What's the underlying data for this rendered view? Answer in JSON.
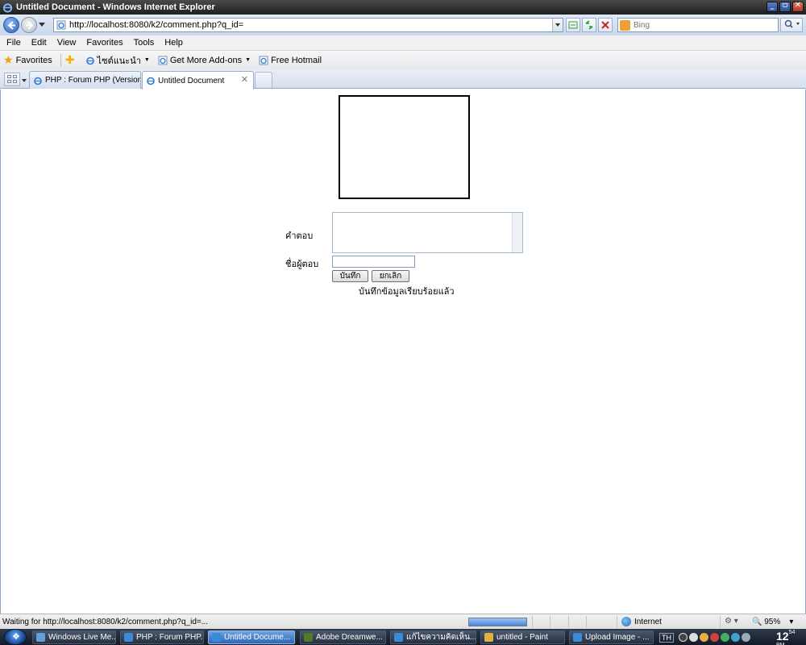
{
  "window": {
    "title": "Untitled Document - Windows Internet Explorer"
  },
  "address": {
    "url": "http://localhost:8080/k2/comment.php?q_id="
  },
  "search": {
    "placeholder": "Bing"
  },
  "menu": [
    "File",
    "Edit",
    "View",
    "Favorites",
    "Tools",
    "Help"
  ],
  "favorites": {
    "label": "Favorites",
    "items": [
      "ไซต์แนะนำ",
      "Get More Add-ons",
      "Free Hotmail"
    ]
  },
  "tabs": [
    {
      "label": "PHP : Forum PHP (Version 3....",
      "active": false
    },
    {
      "label": "Untitled Document",
      "active": true
    }
  ],
  "form": {
    "answer_label": "คำตอบ",
    "answer_value": "",
    "name_label": "ชื่อผู้ตอบ",
    "name_value": "",
    "save_button": "บันทึก",
    "cancel_button": "ยกเลิก",
    "saved_message": "บันทึกข้อมูลเรียบร้อยแล้ว"
  },
  "status": {
    "text": "Waiting for http://localhost:8080/k2/comment.php?q_id=...",
    "zone": "Internet",
    "zoom": "95%",
    "progress": 1.0
  },
  "taskbar": {
    "items": [
      {
        "label": "Windows Live Me...",
        "active": false,
        "icon_color": "#5fa0dc"
      },
      {
        "label": "PHP : Forum PHP...",
        "active": false,
        "icon_color": "#3a8ad8"
      },
      {
        "label": "Untitled Docume...",
        "active": true,
        "icon_color": "#3a8ad8"
      },
      {
        "label": "Adobe Dreamwe...",
        "active": false,
        "icon_color": "#4f7a2a"
      },
      {
        "label": "แก้ไขความคิดเห็น...",
        "active": false,
        "icon_color": "#3a8ad8"
      },
      {
        "label": "untitled - Paint",
        "active": false,
        "icon_color": "#e0b040"
      },
      {
        "label": "Upload Image - ...",
        "active": false,
        "icon_color": "#3a8ad8"
      }
    ],
    "lang": "TH",
    "clock_hour": "12",
    "clock_min": "54",
    "clock_ampm": "PM"
  }
}
